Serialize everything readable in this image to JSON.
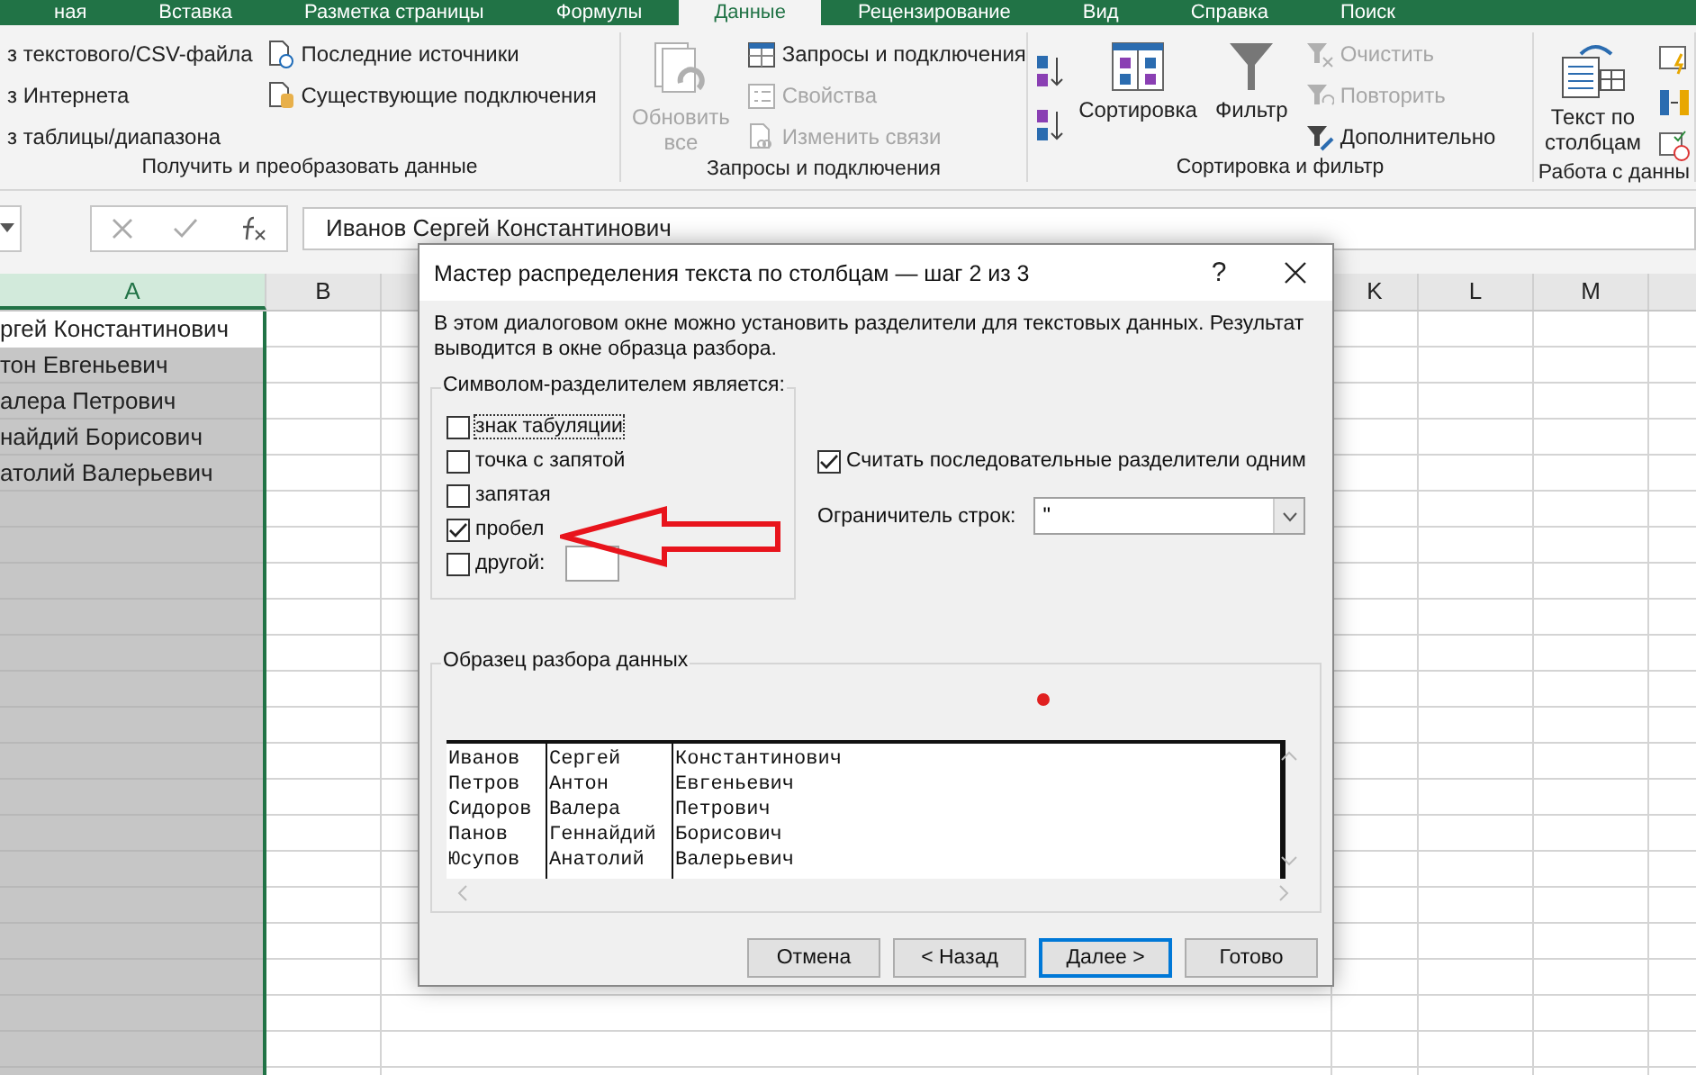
{
  "ribbon_tabs": [
    {
      "label": "ная",
      "selected": false
    },
    {
      "label": "Вставка",
      "selected": false
    },
    {
      "label": "Разметка страницы",
      "selected": false
    },
    {
      "label": "Формулы",
      "selected": false
    },
    {
      "label": "Данные",
      "selected": true
    },
    {
      "label": "Рецензирование",
      "selected": false
    },
    {
      "label": "Вид",
      "selected": false
    },
    {
      "label": "Справка",
      "selected": false
    },
    {
      "label": "Поиск",
      "selected": false
    }
  ],
  "ribbon_groups": [
    {
      "label": "Получить и преобразовать данные",
      "items": [
        {
          "kind": "small",
          "label": "з текстового/CSV-файла",
          "disabled": false
        },
        {
          "kind": "small",
          "label": "з Интернета",
          "disabled": false
        },
        {
          "kind": "small",
          "label": "з таблицы/диапазона",
          "disabled": false
        },
        {
          "kind": "small",
          "label": "Последние источники",
          "disabled": false
        },
        {
          "kind": "small",
          "label": "Существующие подключения",
          "disabled": false
        }
      ]
    },
    {
      "label": "Запросы и подключения",
      "items": [
        {
          "kind": "large",
          "label": "Обновить все",
          "disabled": true
        },
        {
          "kind": "small",
          "label": "Запросы и подключения",
          "disabled": false
        },
        {
          "kind": "small",
          "label": "Свойства",
          "disabled": true
        },
        {
          "kind": "small",
          "label": "Изменить связи",
          "disabled": true
        }
      ]
    },
    {
      "label": "Сортировка и фильтр",
      "items": [
        {
          "kind": "icons"
        },
        {
          "kind": "large",
          "label": "Сортировка",
          "disabled": false
        },
        {
          "kind": "large",
          "label": "Фильтр",
          "disabled": false
        },
        {
          "kind": "small",
          "label": "Очистить",
          "disabled": true
        },
        {
          "kind": "small",
          "label": "Повторить",
          "disabled": true
        },
        {
          "kind": "small",
          "label": "Дополнительно",
          "disabled": false
        }
      ]
    },
    {
      "label": "Работа с данны",
      "items": [
        {
          "kind": "large",
          "label": "Текст по столбцам",
          "disabled": false
        },
        {
          "kind": "icons"
        }
      ]
    }
  ],
  "formula_bar": {
    "value": "Иванов Сергей Константинович"
  },
  "sheet": {
    "columns": [
      {
        "label": "A",
        "selected": true
      },
      {
        "label": "B",
        "selected": false
      },
      {
        "label": "K",
        "selected": false
      },
      {
        "label": "L",
        "selected": false
      },
      {
        "label": "M",
        "selected": false
      }
    ],
    "rows": [
      {
        "a": "ргей Константинович",
        "active": true
      },
      {
        "a": "тон Евгеньевич",
        "active": false
      },
      {
        "a": "алера Петрович",
        "active": false
      },
      {
        "a": "найдий Борисович",
        "active": false
      },
      {
        "a": "атолий Валерьевич",
        "active": false
      }
    ]
  },
  "dialog": {
    "title": "Мастер распределения текста по столбцам — шаг 2 из 3",
    "help": "?",
    "description": "В этом диалоговом окне можно установить разделители для текстовых данных. Результат выводится в окне образца разбора.",
    "delimiters": {
      "legend": "Символом-разделителем является:",
      "options": [
        {
          "kind": "plain",
          "label": "знак табуляции",
          "checked": false,
          "focused": true
        },
        {
          "kind": "plain",
          "label": "точка с запятой",
          "checked": false,
          "focused": false
        },
        {
          "kind": "plain",
          "label": "запятая",
          "checked": false,
          "focused": false
        },
        {
          "kind": "plain",
          "label": "пробел",
          "checked": true,
          "focused": false
        },
        {
          "kind": "input",
          "label": "другой:",
          "checked": false,
          "focused": false
        }
      ]
    },
    "consecutive": {
      "label": "Считать последовательные разделители одним",
      "checked": true
    },
    "qualifier": {
      "label": "Ограничитель строк:",
      "value": "\""
    },
    "preview": {
      "legend": "Образец разбора данных",
      "rows": [
        [
          "Иванов",
          "Сергей",
          "Константинович"
        ],
        [
          "Петров",
          "Антон",
          "Евгеньевич"
        ],
        [
          "Сидоров",
          "Валера",
          "Петрович"
        ],
        [
          "Панов",
          "Геннайдий",
          "Борисович"
        ],
        [
          "Юсупов",
          "Анатолий",
          "Валерьевич"
        ]
      ]
    },
    "buttons": [
      {
        "label": "Отмена",
        "default": false
      },
      {
        "label": "< Назад",
        "default": false
      },
      {
        "label": "Далее >",
        "default": true
      },
      {
        "label": "Готово",
        "default": false
      }
    ]
  }
}
